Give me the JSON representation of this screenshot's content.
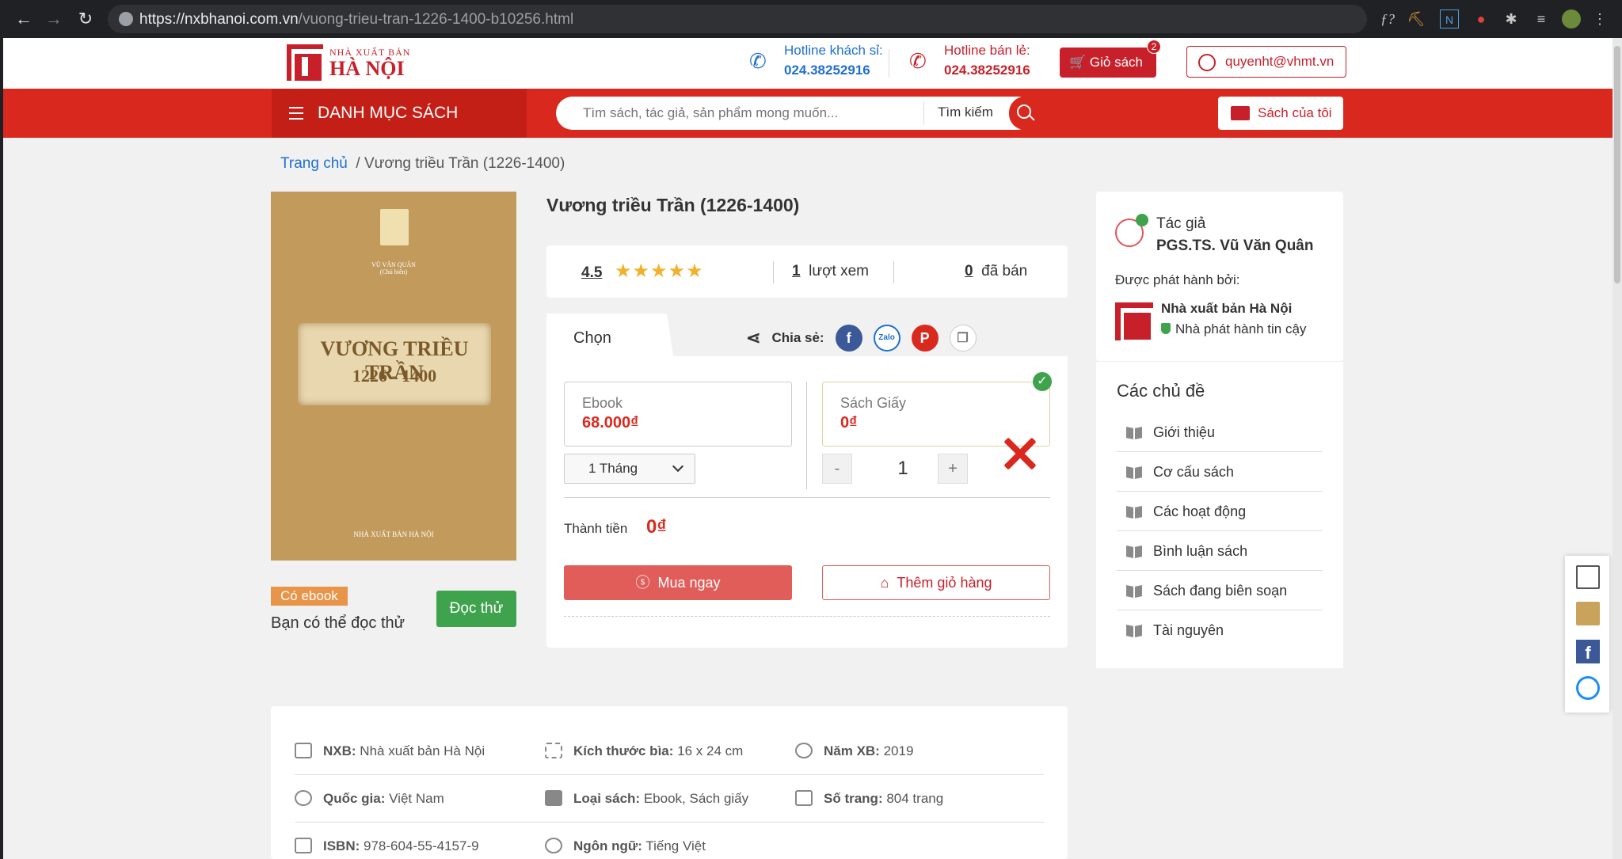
{
  "browser": {
    "url_host": "https://nxbhanoi.com.vn",
    "url_path": "/vuong-trieu-tran-1226-1400-b10256.html"
  },
  "header": {
    "logo_small": "NHÀ XUẤT BẢN",
    "logo_big": "HÀ NỘI",
    "hotline_guest_label": "Hotline khách sỉ:",
    "hotline_guest_number": "024.38252916",
    "hotline_retail_label": "Hotline bán lẻ:",
    "hotline_retail_number": "024.38252916",
    "cart_label": "Giỏ sách",
    "cart_count": "2",
    "user_email": "quyenht@vhmt.vn"
  },
  "nav": {
    "categories_label": "DANH MỤC SÁCH",
    "search_placeholder": "Tìm sách, tác giả, sản phẩm mong muốn...",
    "search_button": "Tìm kiếm",
    "my_books_label": "Sách của tôi"
  },
  "breadcrumb": {
    "home": "Trang chủ",
    "current": "/ Vương triều Trần (1226-1400)"
  },
  "cover": {
    "author": "VŨ VĂN QUÂN",
    "editor_note": "(Chủ biên)",
    "title_line1": "VƯƠNG TRIỀU TRẦN",
    "title_line2": "1226 - 1400",
    "publisher": "NHÀ XUẤT BẢN HÀ NỘI"
  },
  "ebook": {
    "badge": "Có ebook",
    "note": "Bạn có thể đọc thử",
    "read_button": "Đọc thử"
  },
  "product": {
    "title": "Vương triều Trần (1226-1400)",
    "rating": "4.5",
    "stars": "★★★★★",
    "views_count": "1",
    "views_label": "lượt xem",
    "sold_count": "0",
    "sold_label": "đã bán",
    "tab_label": "Chọn",
    "share_label": "Chia sẻ:",
    "ebook_type": "Ebook",
    "ebook_price": "68.000₫",
    "paper_type": "Sách Giấy",
    "paper_price": "0₫",
    "duration": "1 Tháng",
    "qty_minus": "-",
    "qty": "1",
    "qty_plus": "+",
    "total_label": "Thành tiền",
    "total_value": "0₫",
    "buy_button": "Mua ngay",
    "add_cart_button": "Thêm giỏ hàng"
  },
  "author_card": {
    "label": "Tác giả",
    "name": "PGS.TS. Vũ Văn Quân",
    "published_by": "Được phát hành bởi:",
    "publisher_name": "Nhà xuất bản Hà Nội",
    "publisher_trust": "Nhà phát hành tin cậy"
  },
  "topics": {
    "heading": "Các chủ đề",
    "items": [
      "Giới thiệu",
      "Cơ cấu sách",
      "Các hoạt động",
      "Bình luận sách",
      "Sách đang biên soạn",
      "Tài nguyên"
    ]
  },
  "info": {
    "nxb_label": "NXB:",
    "nxb_value": "Nhà xuất bản Hà Nội",
    "size_label": "Kích thước bìa:",
    "size_value": "16 x 24 cm",
    "year_label": "Năm XB:",
    "year_value": "2019",
    "country_label": "Quốc gia:",
    "country_value": "Việt Nam",
    "type_label": "Loại sách:",
    "type_value": "Ebook, Sách giấy",
    "pages_label": "Số trang:",
    "pages_value": "804 trang",
    "isbn_label": "ISBN:",
    "isbn_value": "978-604-55-4157-9",
    "lang_label": "Ngôn ngữ:",
    "lang_value": "Tiếng Việt"
  },
  "colors": {
    "brand_red": "#d9291f",
    "link_blue": "#1f6fd1",
    "green": "#3fa34d"
  }
}
